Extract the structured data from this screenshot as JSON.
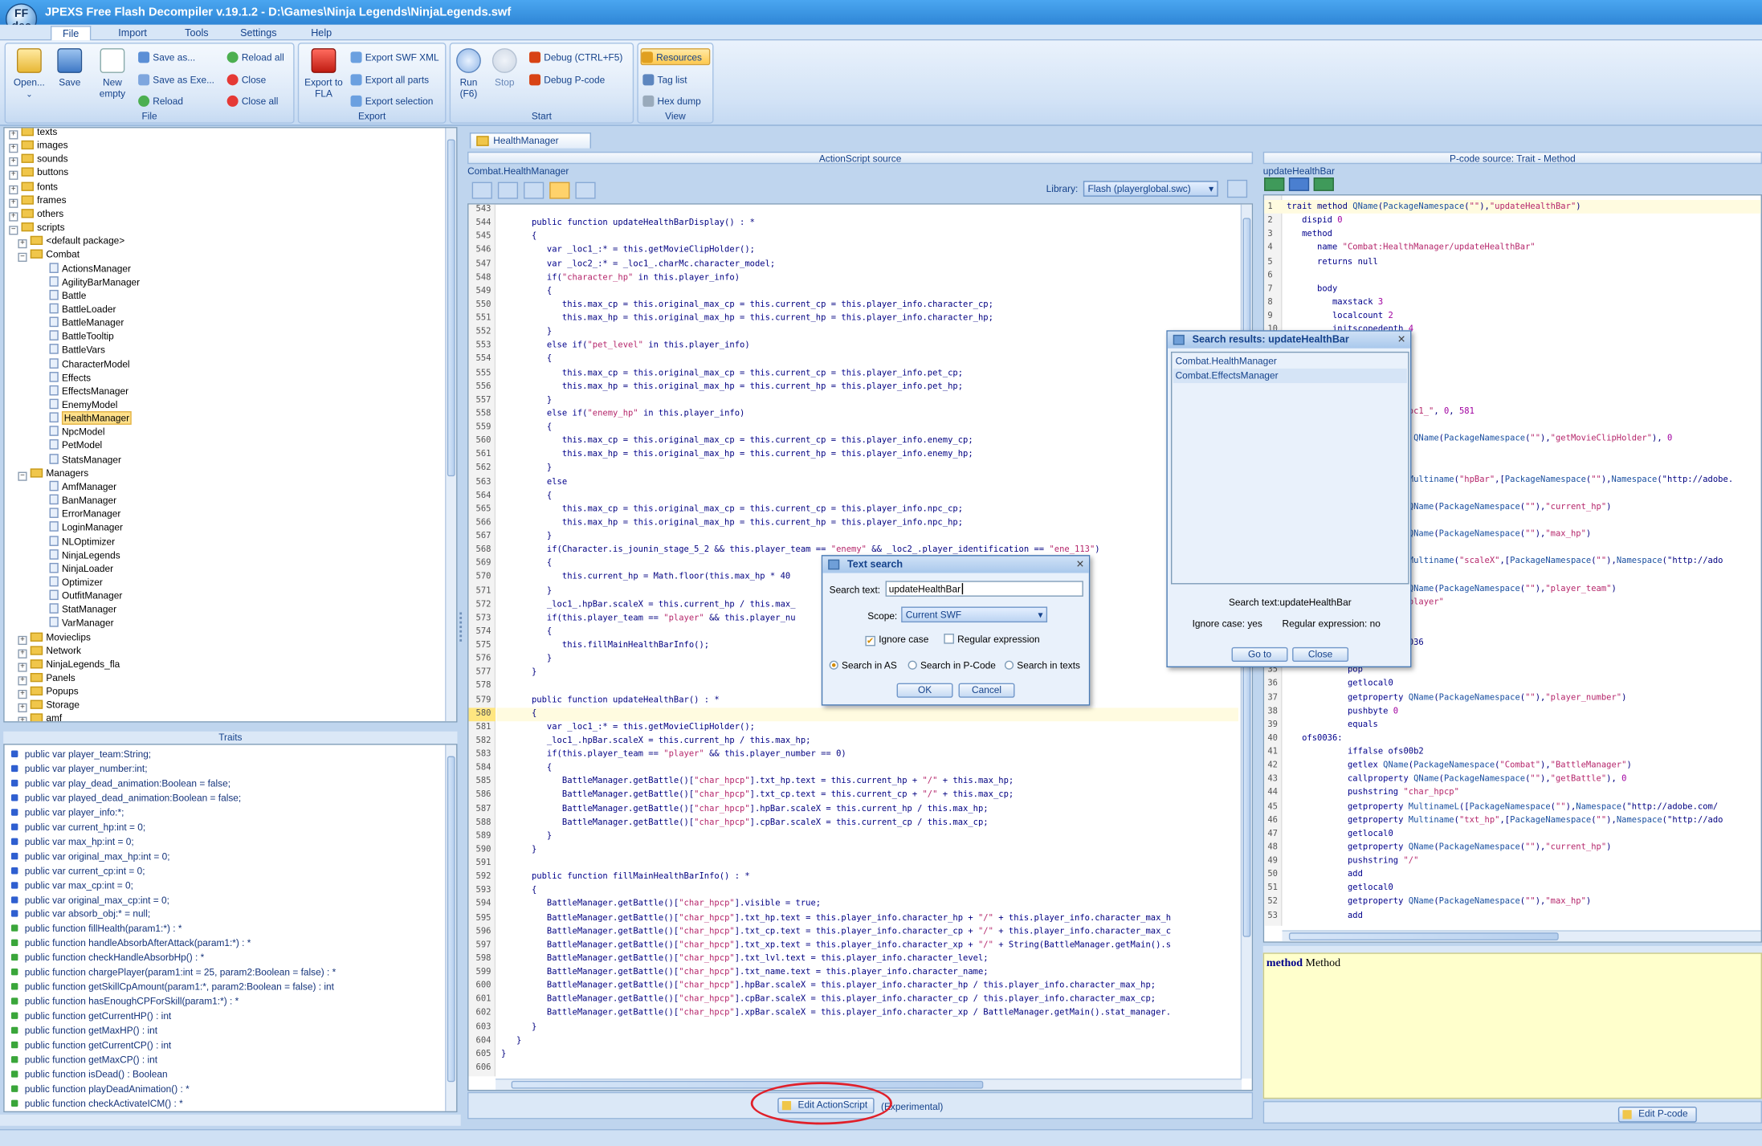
{
  "window": {
    "title": "JPEXS Free Flash Decompiler v.19.1.2 - D:\\Games\\Ninja Legends\\NinjaLegends.swf",
    "logo_text": "FF dec"
  },
  "menu": [
    "File",
    "Import",
    "Tools",
    "Settings",
    "Help"
  ],
  "ribbon": {
    "file": {
      "open": "Open...",
      "save": "Save",
      "new_empty": "New empty",
      "save_as": "Save as...",
      "save_as_exe": "Save as Exe...",
      "reload": "Reload",
      "reload_all": "Reload all",
      "close": "Close",
      "close_all": "Close all",
      "label": "File"
    },
    "export": {
      "export_fla": "Export to FLA",
      "export_swf_xml": "Export SWF XML",
      "export_all_parts": "Export all parts",
      "export_selection": "Export selection",
      "label": "Export"
    },
    "start": {
      "run": "Run (F6)",
      "stop": "Stop",
      "debug": "Debug (CTRL+F5)",
      "debug_pcode": "Debug P-code",
      "label": "Start"
    },
    "view": {
      "resources": "Resources",
      "tag_list": "Tag list",
      "hex_dump": "Hex dump",
      "label": "View"
    }
  },
  "tree": {
    "top_items": [
      "texts",
      "images",
      "sounds",
      "buttons",
      "fonts",
      "frames",
      "others"
    ],
    "scripts": "scripts",
    "default_package": "<default package>",
    "combat": "Combat",
    "combat_items": [
      "ActionsManager",
      "AgilityBarManager",
      "Battle",
      "BattleLoader",
      "BattleManager",
      "BattleTooltip",
      "BattleVars",
      "CharacterModel",
      "Effects",
      "EffectsManager",
      "EnemyModel",
      "HealthManager",
      "NpcModel",
      "PetModel",
      "StatsManager"
    ],
    "selected": "HealthManager",
    "managers": "Managers",
    "managers_items": [
      "AmfManager",
      "BanManager",
      "ErrorManager",
      "LoginManager",
      "NLOptimizer",
      "NinjaLegends",
      "NinjaLoader",
      "Optimizer",
      "OutfitManager",
      "StatManager",
      "VarManager"
    ],
    "bottom_folders": [
      "Movieclips",
      "Network",
      "NinjaLegends_fla",
      "Panels",
      "Popups",
      "Storage",
      "amf"
    ]
  },
  "traits": {
    "title": "Traits",
    "items": [
      {
        "text": "public var player_team:String;",
        "kind": "var"
      },
      {
        "text": "public var player_number:int;",
        "kind": "var"
      },
      {
        "text": "public var play_dead_animation:Boolean = false;",
        "kind": "var"
      },
      {
        "text": "public var played_dead_animation:Boolean = false;",
        "kind": "var"
      },
      {
        "text": "public var player_info:*;",
        "kind": "var"
      },
      {
        "text": "public var current_hp:int = 0;",
        "kind": "var"
      },
      {
        "text": "public var max_hp:int = 0;",
        "kind": "var"
      },
      {
        "text": "public var original_max_hp:int = 0;",
        "kind": "var"
      },
      {
        "text": "public var current_cp:int = 0;",
        "kind": "var"
      },
      {
        "text": "public var max_cp:int = 0;",
        "kind": "var"
      },
      {
        "text": "public var original_max_cp:int = 0;",
        "kind": "var"
      },
      {
        "text": "public var absorb_obj:* = null;",
        "kind": "var"
      },
      {
        "text": "public function fillHealth(param1:*) : *",
        "kind": "fn"
      },
      {
        "text": "public function handleAbsorbAfterAttack(param1:*) : *",
        "kind": "fn"
      },
      {
        "text": "public function checkHandleAbsorbHp() : *",
        "kind": "fn"
      },
      {
        "text": "public function chargePlayer(param1:int = 25, param2:Boolean = false) : *",
        "kind": "fn"
      },
      {
        "text": "public function getSkillCpAmount(param1:*, param2:Boolean = false) : int",
        "kind": "fn"
      },
      {
        "text": "public function hasEnoughCPForSkill(param1:*) : *",
        "kind": "fn"
      },
      {
        "text": "public function getCurrentHP() : int",
        "kind": "fn"
      },
      {
        "text": "public function getMaxHP() : int",
        "kind": "fn"
      },
      {
        "text": "public function getCurrentCP() : int",
        "kind": "fn"
      },
      {
        "text": "public function getMaxCP() : int",
        "kind": "fn"
      },
      {
        "text": "public function isDead() : Boolean",
        "kind": "fn"
      },
      {
        "text": "public function playDeadAnimation() : *",
        "kind": "fn"
      },
      {
        "text": "public function checkActivateICM() : *",
        "kind": "fn"
      }
    ],
    "colors": {
      "var": "#2f5fd0",
      "fn": "#3aa63a"
    }
  },
  "editor": {
    "tab": "HealthManager",
    "header": "ActionScript source",
    "class_path": "Combat.HealthManager",
    "library_label": "Library:",
    "library_value": "Flash (playerglobal.swc)",
    "first_line": 543,
    "current_line": 580,
    "lines": [
      "",
      "      public function updateHealthBarDisplay() : *",
      "      {",
      "         var _loc1_:* = this.getMovieClipHolder();",
      "         var _loc2_:* = _loc1_.charMc.character_model;",
      "         if(\"character_hp\" in this.player_info)",
      "         {",
      "            this.max_cp = this.original_max_cp = this.current_cp = this.player_info.character_cp;",
      "            this.max_hp = this.original_max_hp = this.current_hp = this.player_info.character_hp;",
      "         }",
      "         else if(\"pet_level\" in this.player_info)",
      "         {",
      "            this.max_cp = this.original_max_cp = this.current_cp = this.player_info.pet_cp;",
      "            this.max_hp = this.original_max_hp = this.current_hp = this.player_info.pet_hp;",
      "         }",
      "         else if(\"enemy_hp\" in this.player_info)",
      "         {",
      "            this.max_cp = this.original_max_cp = this.current_cp = this.player_info.enemy_cp;",
      "            this.max_hp = this.original_max_hp = this.current_hp = this.player_info.enemy_hp;",
      "         }",
      "         else",
      "         {",
      "            this.max_cp = this.original_max_cp = this.current_cp = this.player_info.npc_cp;",
      "            this.max_hp = this.original_max_hp = this.current_hp = this.player_info.npc_hp;",
      "         }",
      "         if(Character.is_jounin_stage_5_2 && this.player_team == \"enemy\" && _loc2_.player_identification == \"ene_113\")",
      "         {",
      "            this.current_hp = Math.floor(this.max_hp * 40",
      "         }",
      "         _loc1_.hpBar.scaleX = this.current_hp / this.max_",
      "         if(this.player_team == \"player\" && this.player_nu",
      "         {",
      "            this.fillMainHealthBarInfo();",
      "         }",
      "      }",
      "",
      "      public function updateHealthBar() : *",
      "      {",
      "         var _loc1_:* = this.getMovieClipHolder();",
      "         _loc1_.hpBar.scaleX = this.current_hp / this.max_hp;",
      "         if(this.player_team == \"player\" && this.player_number == 0)",
      "         {",
      "            BattleManager.getBattle()[\"char_hpcp\"].txt_hp.text = this.current_hp + \"/\" + this.max_hp;",
      "            BattleManager.getBattle()[\"char_hpcp\"].txt_cp.text = this.current_cp + \"/\" + this.max_cp;",
      "            BattleManager.getBattle()[\"char_hpcp\"].hpBar.scaleX = this.current_hp / this.max_hp;",
      "            BattleManager.getBattle()[\"char_hpcp\"].cpBar.scaleX = this.current_cp / this.max_cp;",
      "         }",
      "      }",
      "",
      "      public function fillMainHealthBarInfo() : *",
      "      {",
      "         BattleManager.getBattle()[\"char_hpcp\"].visible = true;",
      "         BattleManager.getBattle()[\"char_hpcp\"].txt_hp.text = this.player_info.character_hp + \"/\" + this.player_info.character_max_h",
      "         BattleManager.getBattle()[\"char_hpcp\"].txt_cp.text = this.player_info.character_cp + \"/\" + this.player_info.character_max_c",
      "         BattleManager.getBattle()[\"char_hpcp\"].txt_xp.text = this.player_info.character_xp + \"/\" + String(BattleManager.getMain().s",
      "         BattleManager.getBattle()[\"char_hpcp\"].txt_lvl.text = this.player_info.character_level;",
      "         BattleManager.getBattle()[\"char_hpcp\"].txt_name.text = this.player_info.character_name;",
      "         BattleManager.getBattle()[\"char_hpcp\"].hpBar.scaleX = this.player_info.character_hp / this.player_info.character_max_hp;",
      "         BattleManager.getBattle()[\"char_hpcp\"].cpBar.scaleX = this.player_info.character_cp / this.player_info.character_max_cp;",
      "         BattleManager.getBattle()[\"char_hpcp\"].xpBar.scaleX = this.player_info.character_xp / BattleManager.getMain().stat_manager.",
      "      }",
      "   }",
      "}",
      ""
    ],
    "edit_button": "Edit ActionScript",
    "experimental": "(Experimental)"
  },
  "pcode": {
    "header": "P-code source: Trait - Method",
    "method_name": "updateHealthBar",
    "lines": [
      {
        "n": "1",
        "t": "trait method QName(PackageNamespace(\"\"),\"updateHealthBar\")"
      },
      {
        "n": "2",
        "t": "   dispid 0"
      },
      {
        "n": "3",
        "t": "   method"
      },
      {
        "n": "4",
        "t": "      name \"Combat:HealthManager/updateHealthBar\""
      },
      {
        "n": "5",
        "t": "      returns null"
      },
      {
        "n": "6",
        "t": ""
      },
      {
        "n": "7",
        "t": "      body"
      },
      {
        "n": "8",
        "t": "         maxstack 3"
      },
      {
        "n": "9",
        "t": "         localcount 2"
      },
      {
        "n": "10",
        "t": "         initscopedepth 4"
      },
      {
        "n": "11",
        "t": "         maxscopedepth 5"
      },
      {
        "n": "12",
        "t": ""
      },
      {
        "n": "13",
        "t": "         code"
      },
      {
        "n": "14",
        "t": "            getlocal0"
      },
      {
        "n": "15",
        "t": "            pushscope"
      },
      {
        "n": "16",
        "t": "            debug 1, \"_loc1_\", 0, 581"
      },
      {
        "n": "17",
        "t": "            getlocal0"
      },
      {
        "n": "18",
        "t": "            callproperty QName(PackageNamespace(\"\"),\"getMovieClipHolder\"), 0"
      },
      {
        "n": "19",
        "t": "            setlocal1"
      },
      {
        "n": "20",
        "t": "            getlocal1"
      },
      {
        "n": "21",
        "t": "            getproperty Multiname(\"hpBar\",[PackageNamespace(\"\"),Namespace(\"http://adobe."
      },
      {
        "n": "22",
        "t": "            getlocal0"
      },
      {
        "n": "23",
        "t": "            getproperty QName(PackageNamespace(\"\"),\"current_hp\")"
      },
      {
        "n": "24",
        "t": "            getlocal0"
      },
      {
        "n": "25",
        "t": "            getproperty QName(PackageNamespace(\"\"),\"max_hp\")"
      },
      {
        "n": "26",
        "t": "            divide"
      },
      {
        "n": "27",
        "t": "            setproperty Multiname(\"scaleX\",[PackageNamespace(\"\"),Namespace(\"http://ado"
      },
      {
        "n": "28",
        "t": "            getlocal0"
      },
      {
        "n": "29",
        "t": "            getproperty QName(PackageNamespace(\"\"),\"player_team\")"
      },
      {
        "n": "30",
        "t": "            pushstring \"player\""
      },
      {
        "n": "31",
        "t": "            equals"
      },
      {
        "n": "32",
        "t": "            dup"
      },
      {
        "n": "33",
        "t": "            iffalse ofs0036"
      },
      {
        "n": "34",
        "t": ""
      },
      {
        "n": "35",
        "t": "            pop"
      },
      {
        "n": "36",
        "t": "            getlocal0"
      },
      {
        "n": "37",
        "t": "            getproperty QName(PackageNamespace(\"\"),\"player_number\")"
      },
      {
        "n": "38",
        "t": "            pushbyte 0"
      },
      {
        "n": "39",
        "t": "            equals"
      },
      {
        "n": "40",
        "t": "   ofs0036:"
      },
      {
        "n": "41",
        "t": "            iffalse ofs00b2"
      },
      {
        "n": "42",
        "t": "            getlex QName(PackageNamespace(\"Combat\"),\"BattleManager\")"
      },
      {
        "n": "43",
        "t": "            callproperty QName(PackageNamespace(\"\"),\"getBattle\"), 0"
      },
      {
        "n": "44",
        "t": "            pushstring \"char_hpcp\""
      },
      {
        "n": "45",
        "t": "            getproperty MultinameL([PackageNamespace(\"\"),Namespace(\"http://adobe.com/"
      },
      {
        "n": "46",
        "t": "            getproperty Multiname(\"txt_hp\",[PackageNamespace(\"\"),Namespace(\"http://ado"
      },
      {
        "n": "47",
        "t": "            getlocal0"
      },
      {
        "n": "48",
        "t": "            getproperty QName(PackageNamespace(\"\"),\"current_hp\")"
      },
      {
        "n": "49",
        "t": "            pushstring \"/\""
      },
      {
        "n": "50",
        "t": "            add"
      },
      {
        "n": "51",
        "t": "            getlocal0"
      },
      {
        "n": "52",
        "t": "            getproperty QName(PackageNamespace(\"\"),\"max_hp\")"
      },
      {
        "n": "53",
        "t": "            add"
      }
    ],
    "doc_keyword": "method",
    "doc_text": "Method",
    "edit_button": "Edit P-code"
  },
  "text_search": {
    "title": "Text search",
    "search_label": "Search text:",
    "search_value": "updateHealthBar",
    "scope_label": "Scope:",
    "scope_value": "Current SWF",
    "ignore_case": "Ignore case",
    "ignore_case_checked": true,
    "regex": "Regular expression",
    "regex_checked": false,
    "search_in_as": "Search in AS",
    "search_in_pcode": "Search in P-Code",
    "search_in_texts": "Search in texts",
    "ok": "OK",
    "cancel": "Cancel"
  },
  "search_results": {
    "title": "Search results: updateHealthBar",
    "items": [
      "Combat.HealthManager",
      "Combat.EffectsManager"
    ],
    "search_text_info": "Search text:updateHealthBar",
    "ignore_case_info": "Ignore case: yes",
    "regex_info": "Regular expression: no",
    "goto": "Go to",
    "close": "Close"
  }
}
